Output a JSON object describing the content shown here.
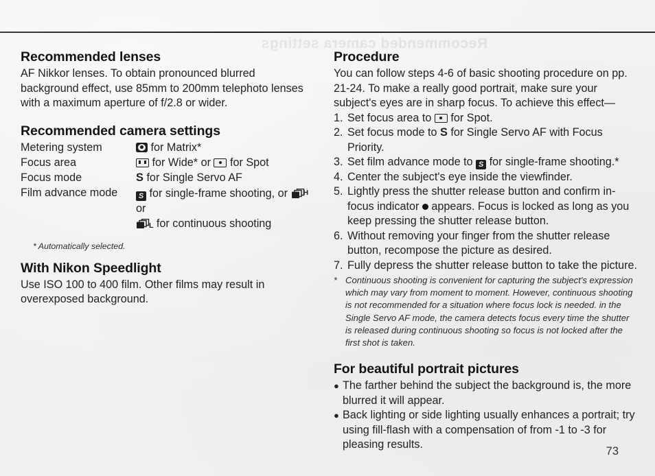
{
  "page": {
    "number": "73",
    "ghost_header": "Recommended camera settings"
  },
  "left_column": {
    "lenses": {
      "heading": "Recommended lenses",
      "body": "AF Nikkor lenses. To obtain pronounced blurred background effect, use 85mm to 200mm telephoto lenses with a maximum aperture of f/2.8 or wider."
    },
    "settings": {
      "heading": "Recommended camera settings",
      "rows": [
        {
          "label": "Metering system",
          "icon": "matrix-metering-icon",
          "value_text": "for Matrix*"
        },
        {
          "label": "Focus area",
          "icon": "wide-focus-area-icon",
          "value_text": "for Wide* or",
          "icon2": "spot-focus-area-icon",
          "value_text2": "for Spot"
        },
        {
          "label": "Focus mode",
          "icon": "letter-s",
          "value_text": "for Single Servo AF"
        },
        {
          "label": "Film advance mode",
          "icon": "single-frame-icon",
          "value_text": "for single-frame shooting, or",
          "icon2": "continuous-high-icon",
          "value_text2": "or",
          "continuation_icon": "continuous-low-icon",
          "continuation_text": "for continuous shooting"
        }
      ],
      "footnote": "* Automatically selected."
    },
    "speedlight": {
      "heading": "With Nikon Speedlight",
      "body": "Use ISO 100 to 400 film. Other films may result in overexposed background."
    }
  },
  "right_column": {
    "procedure": {
      "heading": "Procedure",
      "intro": "You can follow steps 4-6 of basic shooting procedure on pp. 21-24. To make a really good portrait, make sure your subject's eyes are in sharp focus. To achieve this effect—",
      "steps": [
        {
          "num": "1.",
          "before": "Set focus area to",
          "icon": "spot-focus-area-icon",
          "after": "for Spot."
        },
        {
          "num": "2.",
          "before": "Set focus mode to",
          "icon": "letter-s",
          "after": "for Single Servo AF with Focus Priority."
        },
        {
          "num": "3.",
          "before": "Set film advance mode to",
          "icon": "single-frame-icon",
          "after": "for single-frame shooting.*"
        },
        {
          "num": "4.",
          "before": "Center the subject's eye inside the viewfinder.",
          "icon": "",
          "after": ""
        },
        {
          "num": "5.",
          "before": "Lightly press the shutter release button and confirm in-focus indicator",
          "icon": "in-focus-dot-icon",
          "after": "appears. Focus is locked as long as you keep pressing the shutter release button."
        },
        {
          "num": "6.",
          "before": "Without removing your finger from the shutter release button, recompose the picture as desired.",
          "icon": "",
          "after": ""
        },
        {
          "num": "7.",
          "before": "Fully depress the shutter release button to take the picture.",
          "icon": "",
          "after": ""
        }
      ],
      "note_mark": "*",
      "note_text": "Continuous shooting is convenient for capturing the subject's expression which may vary from moment to moment. However, continuous shooting is not recommended for a situation where focus lock is needed. in the Single Servo AF mode, the camera detects focus every time the shutter is released during continuous shooting so focus is not locked after the first shot is taken."
    },
    "portrait_tips": {
      "heading": "For beautiful portrait pictures",
      "bullets": [
        "The farther behind the subject the background is, the more blurred it will appear.",
        "Back lighting or side lighting usually enhances a portrait; try using fill-flash with a compensation of from -1 to -3 for pleasing results."
      ]
    }
  }
}
